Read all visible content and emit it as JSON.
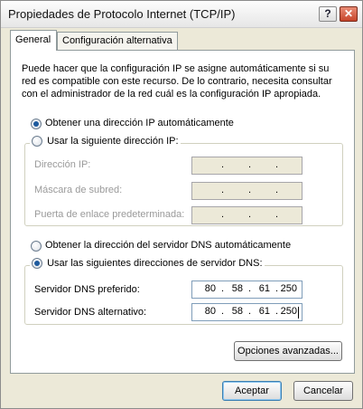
{
  "window": {
    "title": "Propiedades de Protocolo Internet (TCP/IP)",
    "help_glyph": "?",
    "close_glyph": "✕"
  },
  "tabs": [
    {
      "label": "General",
      "active": true
    },
    {
      "label": "Configuración alternativa",
      "active": false
    }
  ],
  "intro_text": "Puede hacer que la configuración IP se asigne automáticamente si su red es compatible con este recurso. De lo contrario, necesita consultar con el administrador de la red cuál es la configuración IP apropiada.",
  "ip": {
    "auto_label": "Obtener una dirección IP automáticamente",
    "manual_label": "Usar la siguiente dirección IP:",
    "selected": "auto",
    "fields": [
      {
        "label": "Dirección IP:",
        "value": [
          "",
          "",
          "",
          ""
        ]
      },
      {
        "label": "Máscara de subred:",
        "value": [
          "",
          "",
          "",
          ""
        ]
      },
      {
        "label": "Puerta de enlace predeterminada:",
        "value": [
          "",
          "",
          "",
          ""
        ]
      }
    ]
  },
  "dns": {
    "auto_label": "Obtener la dirección del servidor DNS automáticamente",
    "manual_label": "Usar las siguientes direcciones de servidor DNS:",
    "selected": "manual",
    "fields": [
      {
        "label": "Servidor DNS preferido:",
        "value": [
          "80",
          "58",
          "61",
          "250"
        ]
      },
      {
        "label": "Servidor DNS alternativo:",
        "value": [
          "80",
          "58",
          "61",
          "250"
        ]
      }
    ]
  },
  "buttons": {
    "advanced": "Opciones avanzadas...",
    "ok": "Aceptar",
    "cancel": "Cancelar"
  },
  "colors": {
    "dialog_bg": "#ece9d8",
    "panel_bg": "#ffffff",
    "close_button": "#c6452b",
    "radio_selected": "#1e5a9e"
  }
}
